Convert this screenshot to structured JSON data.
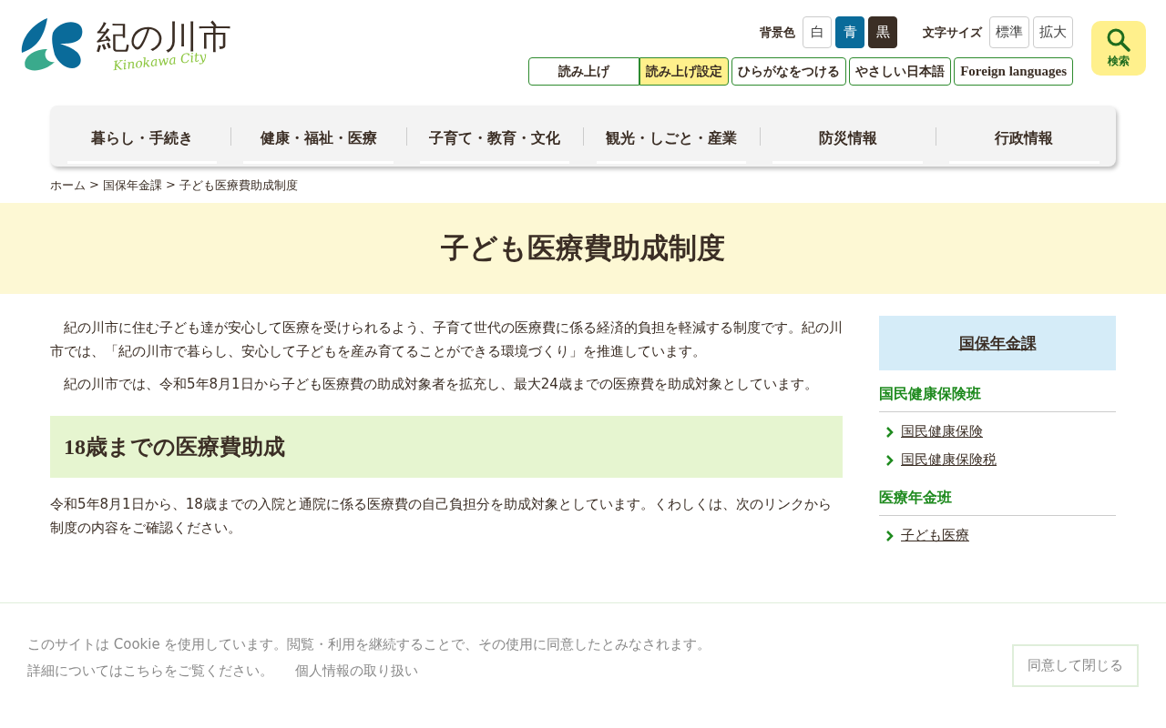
{
  "logo": {
    "name": "紀の川市",
    "sub": "Kinokawa City"
  },
  "bg_color": {
    "label": "背景色",
    "options": [
      {
        "label": "白",
        "selected": false
      },
      {
        "label": "青",
        "selected": true
      },
      {
        "label": "黒",
        "selected": false
      }
    ]
  },
  "font_size": {
    "label": "文字サイズ",
    "options": [
      {
        "label": "標準",
        "selected": false
      },
      {
        "label": "拡大",
        "selected": false
      }
    ]
  },
  "search_button": {
    "label": "検索"
  },
  "tools": [
    {
      "label": "読み上げ",
      "highlighted": false
    },
    {
      "label": "読み上げ設定",
      "highlighted": true
    },
    {
      "label": "ひらがなをつける",
      "highlighted": false
    },
    {
      "label": "やさしい日本語",
      "highlighted": false
    },
    {
      "label": "Foreign languages",
      "highlighted": false
    }
  ],
  "nav": [
    "暮らし・手続き",
    "健康・福祉・医療",
    "子育て・教育・文化",
    "観光・しごと・産業",
    "防災情報",
    "行政情報"
  ],
  "breadcrumb": [
    "ホーム",
    "国保年金課",
    "子ども医療費助成制度"
  ],
  "breadcrumb_separator": ">",
  "page_title": "子ども医療費助成制度",
  "paragraphs": [
    "紀の川市に住む子ども達が安心して医療を受けられるよう、子育て世代の医療費に係る経済的負担を軽減する制度です。紀の川市では、「紀の川市で暮らし、安心して子どもを産み育てることができる環境づくり」を推進しています。",
    "紀の川市では、令和5年8月1日から子ども医療費の助成対象者を拡充し、最大24歳までの医療費を助成対象としています。"
  ],
  "section": {
    "heading": "18歳までの医療費助成",
    "text": "令和5年8月1日から、18歳までの入院と通院に係る医療費の自己負担分を助成対象としています。くわしくは、次のリンクから制度の内容をご確認ください。"
  },
  "sidebar": {
    "title": "国保年金課",
    "groups": [
      {
        "heading": "国民健康保険班",
        "links": [
          "国民健康保険",
          "国民健康保険税"
        ]
      },
      {
        "heading": "医療年金班",
        "links": [
          "子ども医療"
        ]
      }
    ]
  },
  "cookie": {
    "message": "このサイトは Cookie を使用しています。閲覧・利用を継続することで、その使用に同意したとみなされます。",
    "details": "詳細についてはこちらをご覧ください。",
    "privacy_link": "個人情報の取り扱い",
    "accept": "同意して閉じる"
  }
}
